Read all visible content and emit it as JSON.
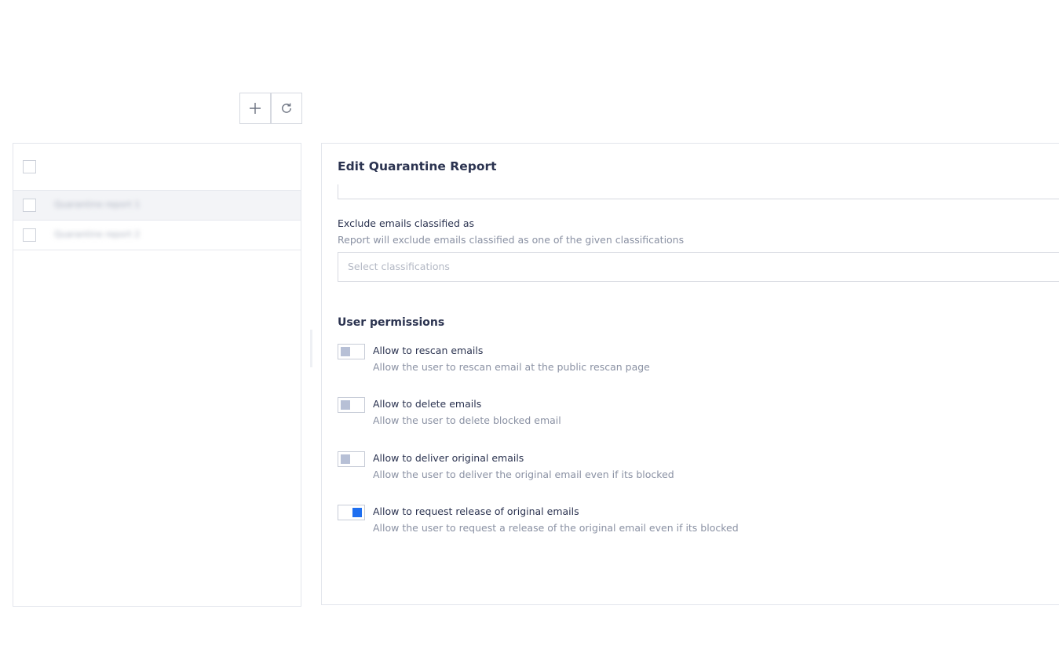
{
  "toolbar": {
    "add_icon": "plus-icon",
    "refresh_icon": "refresh-icon"
  },
  "list": {
    "rows": [
      {
        "text": "Quarantine report 1",
        "selected": true
      },
      {
        "text": "Quarantine report 2",
        "selected": false
      }
    ]
  },
  "detail": {
    "title": "Edit Quarantine Report",
    "exclude": {
      "label": "Exclude emails classified as",
      "help": "Report will exclude emails classified as one of the given classifications",
      "placeholder": "Select classifications"
    },
    "permissions": {
      "title": "User permissions",
      "items": [
        {
          "label": "Allow to rescan emails",
          "help": "Allow the user to rescan email at the public rescan page",
          "enabled": false
        },
        {
          "label": "Allow to delete emails",
          "help": "Allow the user to delete blocked email",
          "enabled": false
        },
        {
          "label": "Allow to deliver original emails",
          "help": "Allow the user to deliver the original email even if its blocked",
          "enabled": false
        },
        {
          "label": "Allow to request release of original emails",
          "help": "Allow the user to request a release of the original email even if its blocked",
          "enabled": true
        }
      ]
    }
  },
  "colors": {
    "accent": "#1f6ff0",
    "toggle_off_knob": "#b7c0d6",
    "text_primary": "#2b3350",
    "text_muted": "#8a91a3"
  }
}
